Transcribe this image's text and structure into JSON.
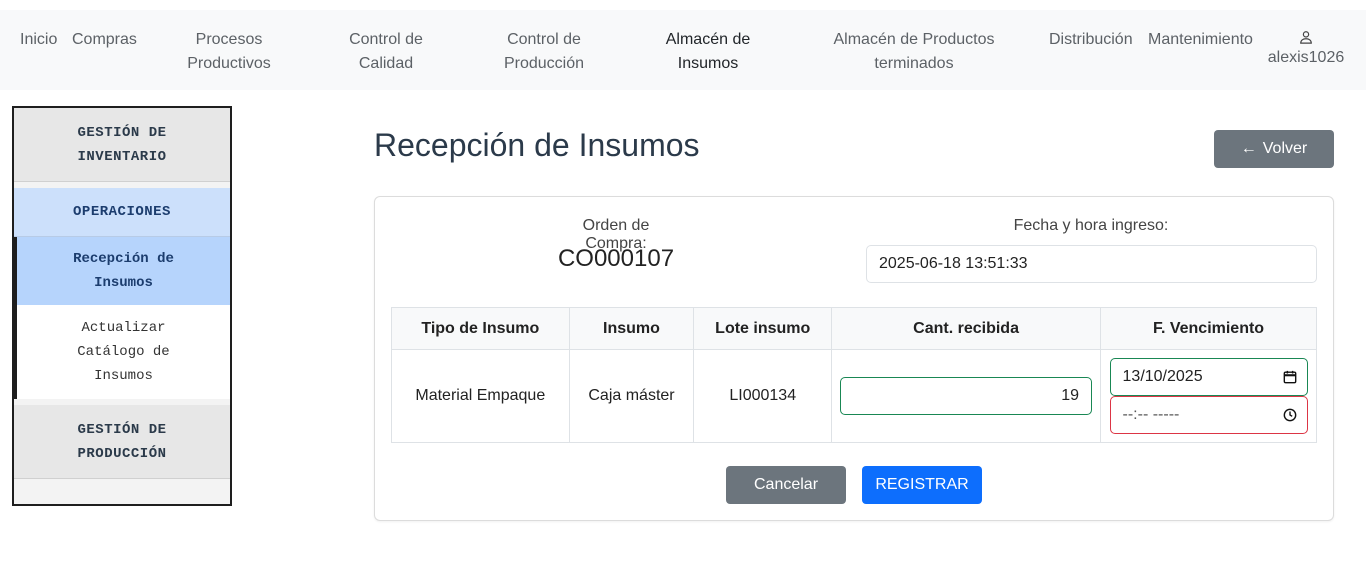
{
  "nav": {
    "items": [
      {
        "line1": "Inicio",
        "line2": ""
      },
      {
        "line1": "Compras",
        "line2": ""
      },
      {
        "line1": "Procesos",
        "line2": "Productivos"
      },
      {
        "line1": "Control de",
        "line2": "Calidad"
      },
      {
        "line1": "Control de",
        "line2": "Producción"
      },
      {
        "line1": "Almacén de",
        "line2": "Insumos"
      },
      {
        "line1": "Almacén de Productos",
        "line2": "terminados"
      },
      {
        "line1": "Distribución",
        "line2": ""
      },
      {
        "line1": "Mantenimiento",
        "line2": ""
      }
    ],
    "user": "alexis1026",
    "user_icon": "user-icon"
  },
  "sidebar": {
    "section1_l1": "GESTIÓN DE",
    "section1_l2": "INVENTARIO",
    "sub": "OPERACIONES",
    "link1_l1": "Recepción de",
    "link1_l2": "Insumos",
    "link2_l1": "Actualizar",
    "link2_l2": "Catálogo de",
    "link2_l3": "Insumos",
    "section2_l1": "GESTIÓN DE",
    "section2_l2": "PRODUCCIÓN"
  },
  "main": {
    "title": "Recepción de Insumos",
    "back_arrow": "←",
    "back_label": "Volver"
  },
  "form": {
    "oc_label": "Orden de Compra:",
    "oc_value": "CO000107",
    "fecha_label": "Fecha y hora ingreso:",
    "fecha_value": "2025-06-18 13:51:33"
  },
  "table": {
    "headers": [
      "Tipo de Insumo",
      "Insumo",
      "Lote insumo",
      "Cant. recibida",
      "F. Vencimiento"
    ],
    "row": {
      "tipo": "Material Empaque",
      "insumo": "Caja máster",
      "lote": "LI000134",
      "cantidad": "19",
      "fecha_venc": "13/10/2025",
      "hora_venc": "--:-- -----"
    }
  },
  "buttons": {
    "cancel": "Cancelar",
    "submit": "REGISTRAR"
  },
  "colors": {
    "navbar_bg": "#f8f9fa",
    "primary": "#0d6efd",
    "secondary": "#6c757d",
    "valid": "#198754",
    "invalid": "#dc3545"
  }
}
